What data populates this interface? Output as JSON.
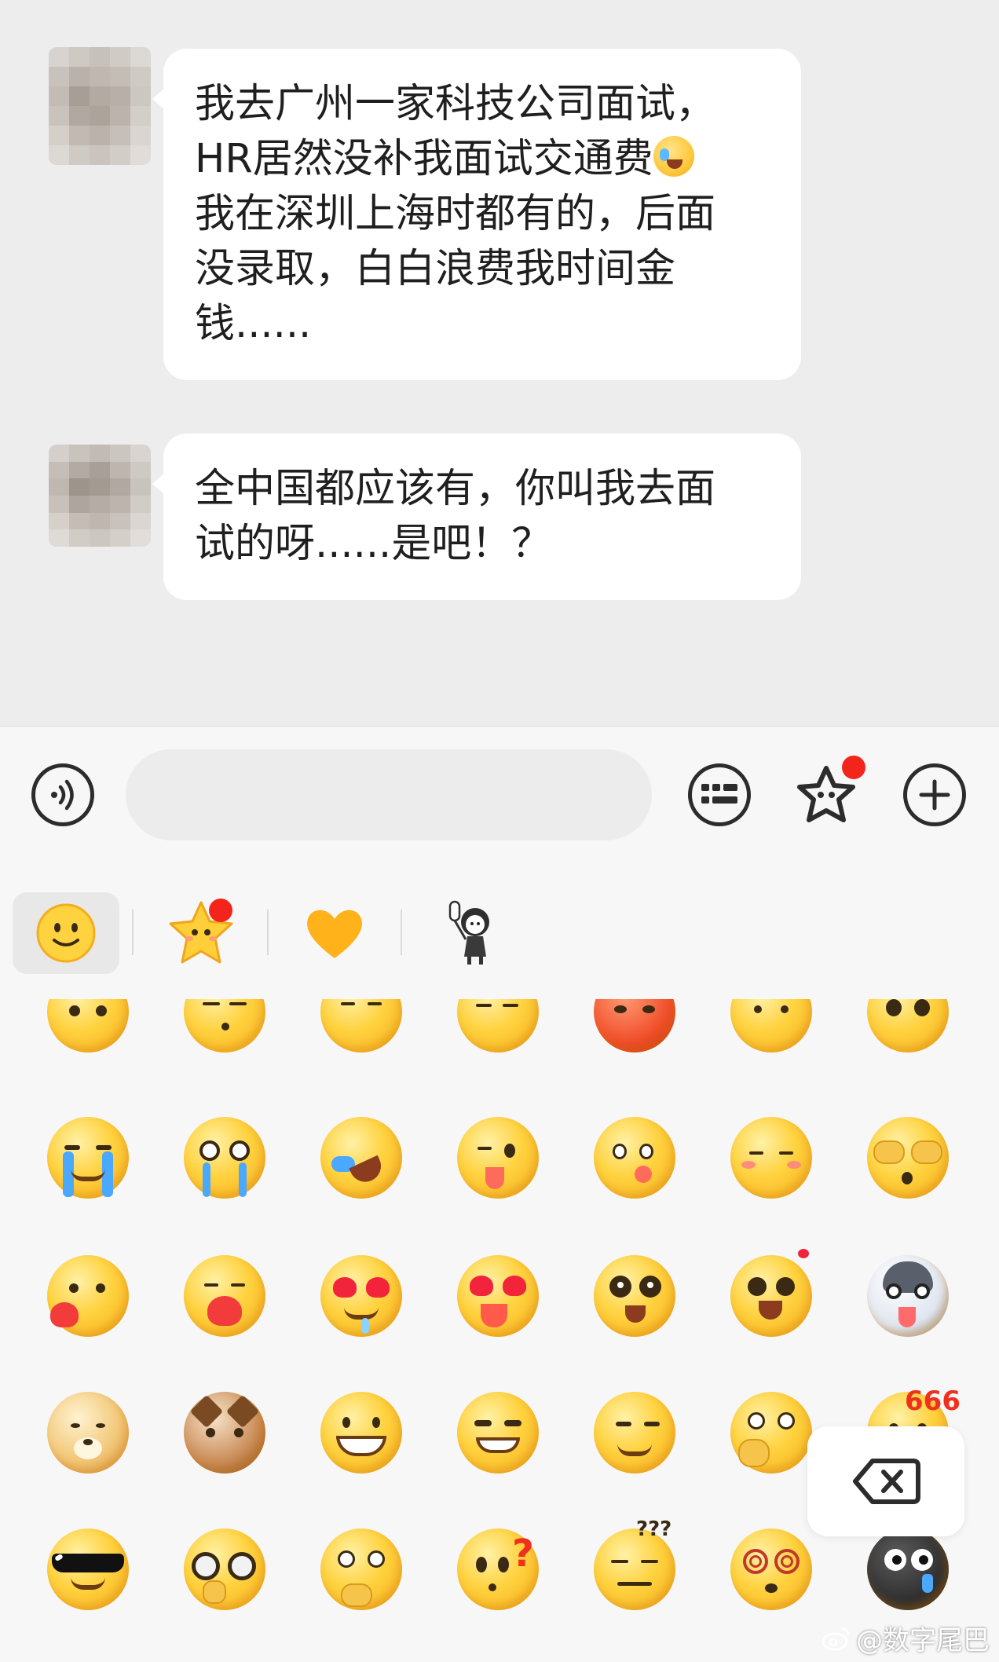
{
  "messages": [
    {
      "lines": [
        "我去广州一家科技公司面试，",
        "HR居然没补我面试交通费",
        "我在深圳上海时都有的，后面",
        "没录取，白白浪费我时间金",
        "钱......"
      ],
      "inline_emoji": "laughing-crying-emoji"
    },
    {
      "lines": [
        "全中国都应该有，你叫我去面",
        "试的呀......是吧！？"
      ]
    }
  ],
  "input_bar": {
    "voice_icon": "voice-icon",
    "input_value": "",
    "keyboard_icon": "keyboard-icon",
    "sticker_icon": "sticker-icon",
    "plus_icon": "plus-icon"
  },
  "emoji_tabs": [
    {
      "icon": "smiley-icon",
      "active": true
    },
    {
      "icon": "star-face-icon",
      "active": false,
      "badge": true
    },
    {
      "icon": "heart-icon",
      "active": false
    },
    {
      "icon": "cartoon-girl-icon",
      "active": false
    }
  ],
  "emoji_grid": [
    [
      "sad-emoji",
      "speechless-emoji",
      "smirk-emoji",
      "annoyed-emoji",
      "angry-emoji",
      "shy-emoji",
      "pleading-emoji"
    ],
    [
      "crying-emoji",
      "tears-emoji",
      "laughing-crying-emoji",
      "wink-tongue-emoji",
      "yummy-emoji",
      "blush-emoji",
      "see-no-evil-emoji"
    ],
    [
      "heart-hold-emoji",
      "hug-emoji",
      "heart-eyes-drool-emoji",
      "heart-eyes-tongue-emoji",
      "starry-eyes-emoji",
      "excited-emoji",
      "husky-emoji"
    ],
    [
      "doge-emoji",
      "cat-emoji",
      "grin-emoji",
      "smug-emoji",
      "side-eye-emoji",
      "cover-mouth-emoji",
      "666-emoji"
    ],
    [
      "sunglasses-emoji",
      "glasses-emoji",
      "thinking-emoji",
      "question-emoji",
      "confused-emoji",
      "dizzy-emoji",
      "black-crying-emoji"
    ]
  ],
  "emoji_666_label": "666",
  "delete_icon": "backspace-icon",
  "watermark": "@数字尾巴",
  "colors": {
    "chat_bg": "#ededed",
    "bubble_bg": "#ffffff",
    "panel_bg": "#f7f7f7",
    "badge_red": "#f2241b",
    "emoji_yellow": "#ffd23f"
  }
}
